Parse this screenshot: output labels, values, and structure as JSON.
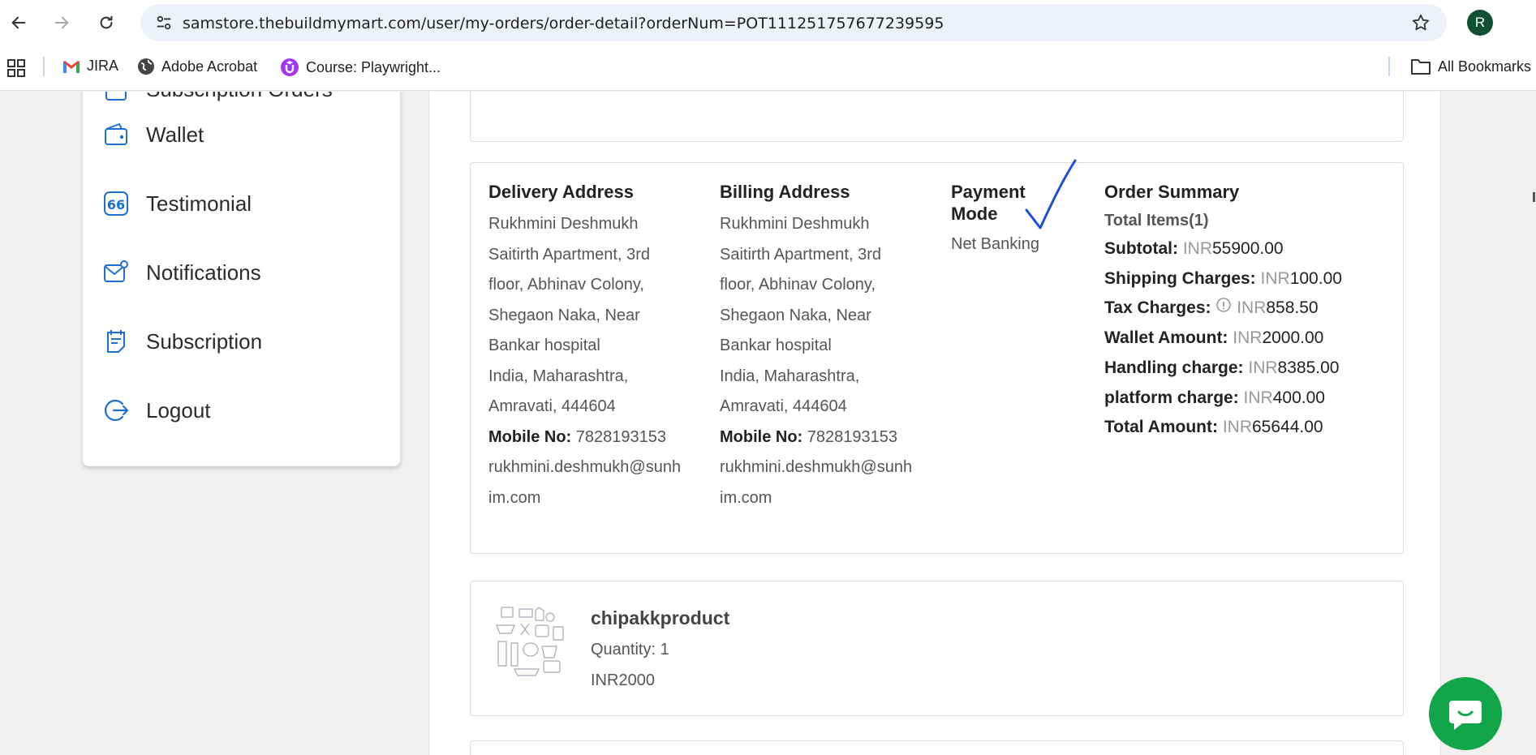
{
  "browser": {
    "url": "samstore.thebuildmymart.com/user/my-orders/order-detail?orderNum=POT111251757677239595",
    "avatar_letter": "R",
    "bookmarks": [
      "JIRA",
      "Adobe Acrobat",
      "Course: Playwright..."
    ],
    "all_bookmarks_label": "All Bookmarks"
  },
  "sidebar": {
    "items": [
      {
        "label": "Subscription Orders",
        "icon": "subscription-orders-icon"
      },
      {
        "label": "Wallet",
        "icon": "wallet-icon"
      },
      {
        "label": "Testimonial",
        "icon": "quote-icon"
      },
      {
        "label": "Notifications",
        "icon": "mail-notification-icon"
      },
      {
        "label": "Subscription",
        "icon": "subscription-icon"
      },
      {
        "label": "Logout",
        "icon": "logout-icon"
      }
    ]
  },
  "order": {
    "delivery": {
      "title": "Delivery Address",
      "lines": [
        "Rukhmini Deshmukh",
        "Saitirth Apartment, 3rd",
        "floor, Abhinav Colony,",
        "Shegaon Naka, Near",
        "Bankar hospital",
        "India, Maharashtra,",
        "Amravati, 444604"
      ],
      "mobile_label": "Mobile No:",
      "mobile": "7828193153",
      "email_lines": [
        "rukhmini.deshmukh@sunh",
        "im.com"
      ]
    },
    "billing": {
      "title": "Billing Address",
      "lines": [
        "Rukhmini Deshmukh",
        "Saitirth Apartment, 3rd",
        "floor, Abhinav Colony,",
        "Shegaon Naka, Near",
        "Bankar hospital",
        "India, Maharashtra,",
        "Amravati, 444604"
      ],
      "mobile_label": "Mobile No:",
      "mobile": "7828193153",
      "email_lines": [
        "rukhmini.deshmukh@sunh",
        "im.com"
      ]
    },
    "payment": {
      "title_line1": "Payment",
      "title_line2": "Mode",
      "value": "Net Banking"
    },
    "summary": {
      "title": "Order Summary",
      "total_items": "Total Items(1)",
      "currency": "INR",
      "rows": [
        {
          "label": "Subtotal:",
          "amount": "55900.00"
        },
        {
          "label": "Shipping Charges:",
          "amount": "100.00"
        },
        {
          "label": "Tax Charges:",
          "amount": "858.50",
          "info": true
        },
        {
          "label": "Wallet Amount:",
          "amount": "2000.00"
        },
        {
          "label": "Handling charge:",
          "amount": "8385.00"
        },
        {
          "label": "platform charge:",
          "amount": "400.00"
        },
        {
          "label": "Total Amount:",
          "amount": "65644.00"
        }
      ]
    }
  },
  "product": {
    "name": "chipakkproduct",
    "quantity": "Quantity: 1",
    "price": "INR2000"
  },
  "colors": {
    "accent_blue": "#1d6fd8",
    "chat_green": "#12a64b",
    "annotation_blue": "#1a4fd6"
  }
}
